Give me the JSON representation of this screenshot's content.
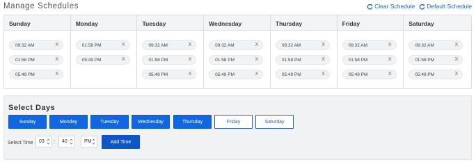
{
  "header": {
    "title": "Manage Schedules",
    "clear_label": "Clear Schedule",
    "default_label": "Default Schedule",
    "accent": "#1565c0"
  },
  "days": [
    {
      "name": "Sunday",
      "times": [
        "09:32 AM",
        "01:58 PM",
        "05:49 PM"
      ]
    },
    {
      "name": "Monday",
      "times": [
        "01:58 PM",
        "05:49 PM"
      ]
    },
    {
      "name": "Tuesday",
      "times": [
        "09:32 AM",
        "01:58 PM",
        "05:49 PM"
      ]
    },
    {
      "name": "Wednesday",
      "times": [
        "09:32 AM",
        "01:58 PM",
        "05:49 PM"
      ]
    },
    {
      "name": "Thursday",
      "times": [
        "09:32 AM",
        "01:58 PM",
        "05:49 PM"
      ]
    },
    {
      "name": "Friday",
      "times": [
        "09:32 AM",
        "01:58 PM",
        "05:49 PM"
      ]
    },
    {
      "name": "Saturday",
      "times": [
        "09:32 AM",
        "01:58 PM",
        "05:49 PM"
      ]
    }
  ],
  "remove_symbol": "X",
  "select_days": {
    "title": "Select Days",
    "buttons": [
      {
        "label": "Sunday",
        "selected": true
      },
      {
        "label": "Monday",
        "selected": true
      },
      {
        "label": "Tuesday",
        "selected": true
      },
      {
        "label": "Wednesday",
        "selected": true
      },
      {
        "label": "Thursday",
        "selected": true
      },
      {
        "label": "Friday",
        "selected": false
      },
      {
        "label": "Saturday",
        "selected": false
      }
    ]
  },
  "time_picker": {
    "label": "Select Time",
    "hour": "03",
    "minute": "40",
    "separator": ":",
    "period": "PM",
    "add_label": "Add Time"
  },
  "colors": {
    "selected_day": "#1167e0",
    "unselected_day_border": "#2b5fa8",
    "add_button": "#0d57c4"
  }
}
